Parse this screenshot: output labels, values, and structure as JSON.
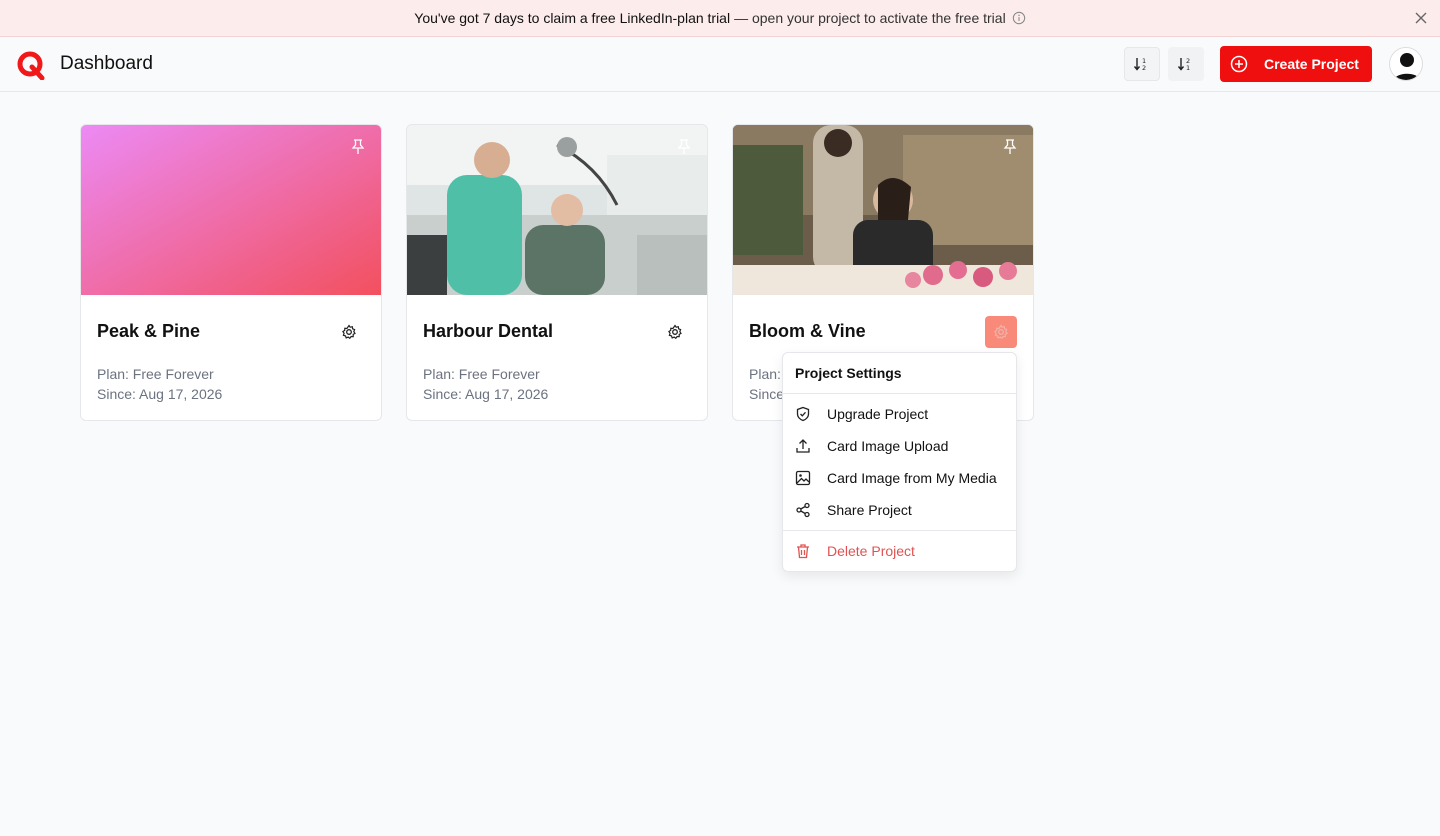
{
  "banner": {
    "main": "You've got 7 days to claim a free LinkedIn-plan trial",
    "rest": "— open your project to activate the free trial"
  },
  "header": {
    "title": "Dashboard",
    "create_label": "Create Project"
  },
  "projects": [
    {
      "name": "Peak & Pine",
      "plan": "Plan: Free Forever",
      "since": "Since: Aug 17, 2026"
    },
    {
      "name": "Harbour Dental",
      "plan": "Plan: Free Forever",
      "since": "Since: Aug 17, 2026"
    },
    {
      "name": "Bloom & Vine",
      "plan": "Plan:",
      "since": "Since"
    }
  ],
  "menu": {
    "title": "Project Settings",
    "items": [
      {
        "label": "Upgrade Project",
        "icon": "shield-check-icon"
      },
      {
        "label": "Card Image Upload",
        "icon": "upload-icon"
      },
      {
        "label": "Card Image from My Media",
        "icon": "image-icon"
      },
      {
        "label": "Share Project",
        "icon": "share-icon"
      },
      {
        "label": "Delete Project",
        "icon": "trash-icon"
      }
    ]
  },
  "colors": {
    "accent": "#f00f0f",
    "banner_bg": "#fdecec",
    "danger": "#e05252"
  }
}
